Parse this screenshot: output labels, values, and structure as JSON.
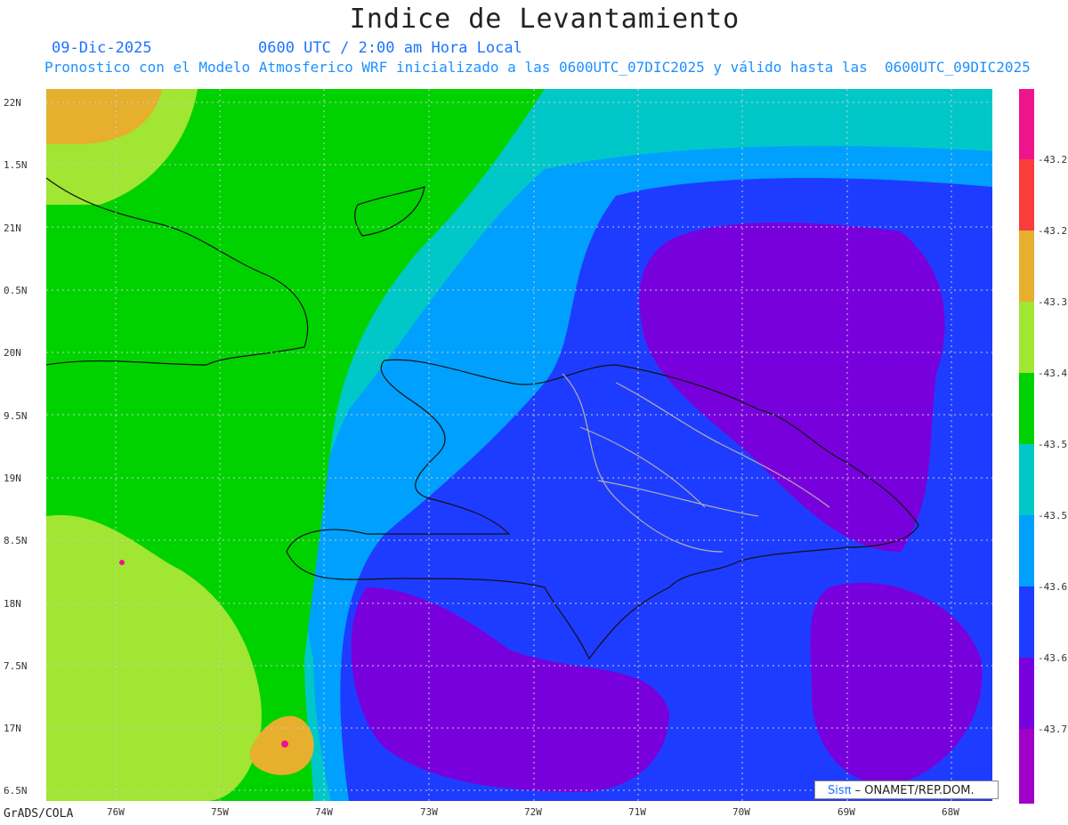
{
  "header": {
    "title": "Indice de Levantamiento",
    "date": "09-Dic-2025",
    "time": "0600 UTC / 2:00 am Hora Local",
    "description": "Pronostico con el Modelo Atmosferico WRF inicializado a las 0600UTC_07DIC2025 y válido hasta las  0600UTC_09DIC2025"
  },
  "axes": {
    "lat_labels": [
      "22N",
      "1.5N",
      "21N",
      "0.5N",
      "20N",
      "9.5N",
      "19N",
      "8.5N",
      "18N",
      "7.5N",
      "17N",
      "6.5N"
    ],
    "lon_labels": [
      "76W",
      "75W",
      "74W",
      "73W",
      "72W",
      "71W",
      "70W",
      "69W",
      "68W"
    ]
  },
  "colorbar": {
    "labels": [
      "-43.2",
      "-43.2",
      "-43.3",
      "-43.4",
      "-43.5",
      "-43.5",
      "-43.6",
      "-43.6",
      "-43.7"
    ],
    "colors": [
      "#f0148c",
      "#fa3c3c",
      "#e6af2d",
      "#a0e632",
      "#00d200",
      "#00c8c8",
      "#00a0ff",
      "#1e3cff",
      "#7800dc",
      "#a000c8"
    ]
  },
  "footer": {
    "logo_brand": "Sisπ",
    "logo_text": "– ONAMET/REP.DOM.",
    "credit": "GrADS/COLA"
  }
}
